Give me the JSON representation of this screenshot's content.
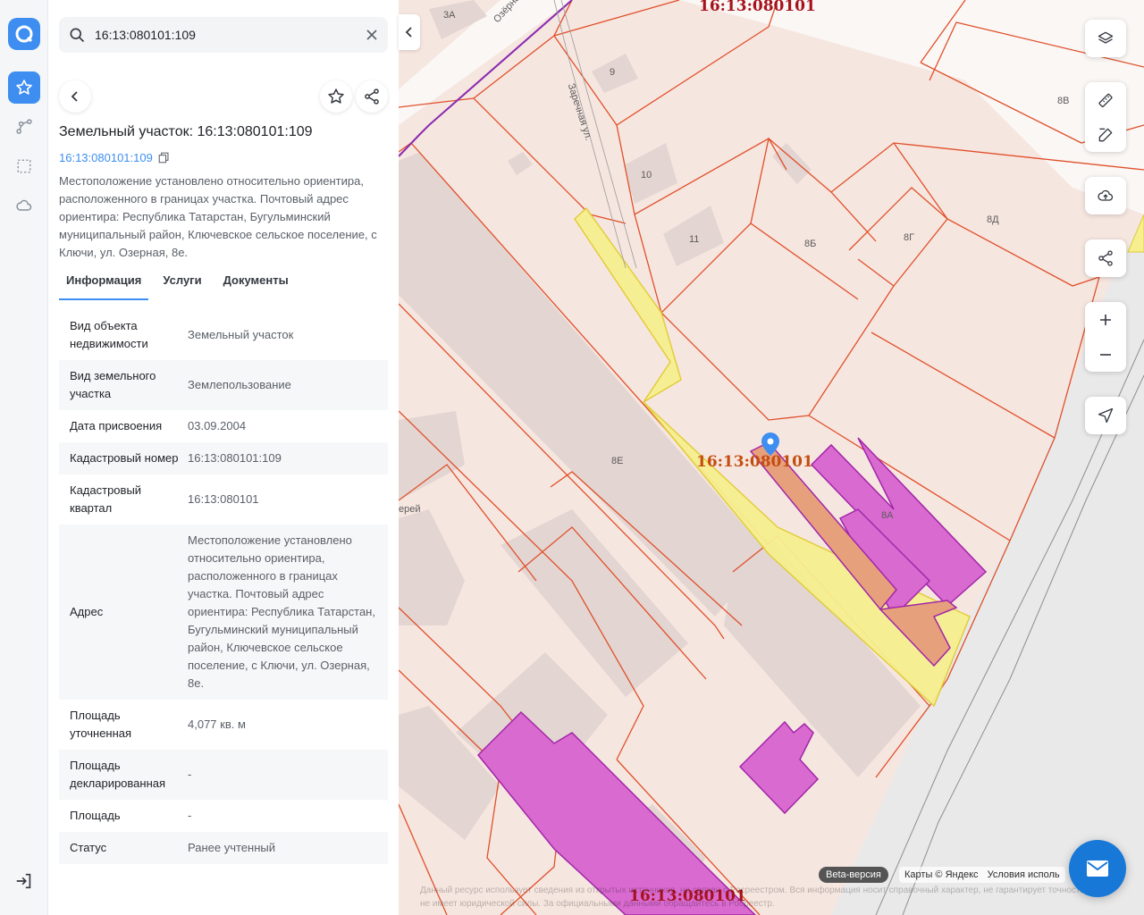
{
  "search": {
    "value": "16:13:080101:109"
  },
  "card": {
    "title": "Земельный участок: 16:13:080101:109",
    "cad_number_link": "16:13:080101:109",
    "description": "Местоположение установлено относительно ориентира, расположенного в границах участка. Почтовый адрес ориентира: Республика Татарстан, Бугульминский муниципальный район, Ключевское сельское поселение, с Ключи, ул. Озерная, 8е."
  },
  "tabs": [
    "Информация",
    "Услуги",
    "Документы"
  ],
  "info_rows": [
    {
      "key": "Вид объекта недвижимости",
      "value": "Земельный участок"
    },
    {
      "key": "Вид земельного участка",
      "value": "Землепользование"
    },
    {
      "key": "Дата присвоения",
      "value": "03.09.2004"
    },
    {
      "key": "Кадастровый номер",
      "value": "16:13:080101:109"
    },
    {
      "key": "Кадастровый квартал",
      "value": "16:13:080101"
    },
    {
      "key": "Адрес",
      "value": "Местоположение установлено относительно ориентира, расположенного в границах участка. Почтовый адрес ориентира: Республика Татарстан, Бугульминский муниципальный район, Ключевское сельское поселение, с Ключи, ул. Озерная, 8е."
    },
    {
      "key": "Площадь уточненная",
      "value": "4,077 кв. м"
    },
    {
      "key": "Площадь декларированная",
      "value": "-"
    },
    {
      "key": "Площадь",
      "value": "-"
    },
    {
      "key": "Статус",
      "value": "Ранее учтенный"
    }
  ],
  "map": {
    "quarter_labels": [
      "16:13:080101",
      "16:13:080101",
      "16:13:080101"
    ],
    "house_labels": [
      "3А",
      "9",
      "10",
      "11",
      "8Б",
      "8Г",
      "8Д",
      "8В",
      "8Е",
      "8А"
    ],
    "street_labels": [
      "Озёрная ул.",
      "Заречная ул.",
      "ерей"
    ],
    "beta": "Beta-версия",
    "attribution": [
      "Карты © Яндекс",
      "Условия исполь"
    ],
    "disclaimer": "Данный ресурс использует сведения из открытых источников, не связан с Росреестром. Вся информация носит справочный характер, не гарантирует точность и не имеет юридической силы. За официальными данными обращайтесь в Росреестр."
  },
  "colors": {
    "accent": "#3d8ef0",
    "parcel_border": "#e0502a",
    "selected_fill": "#f7ef8f",
    "building_fill": "#d96ad0",
    "quarter_label": "#a5141e"
  }
}
